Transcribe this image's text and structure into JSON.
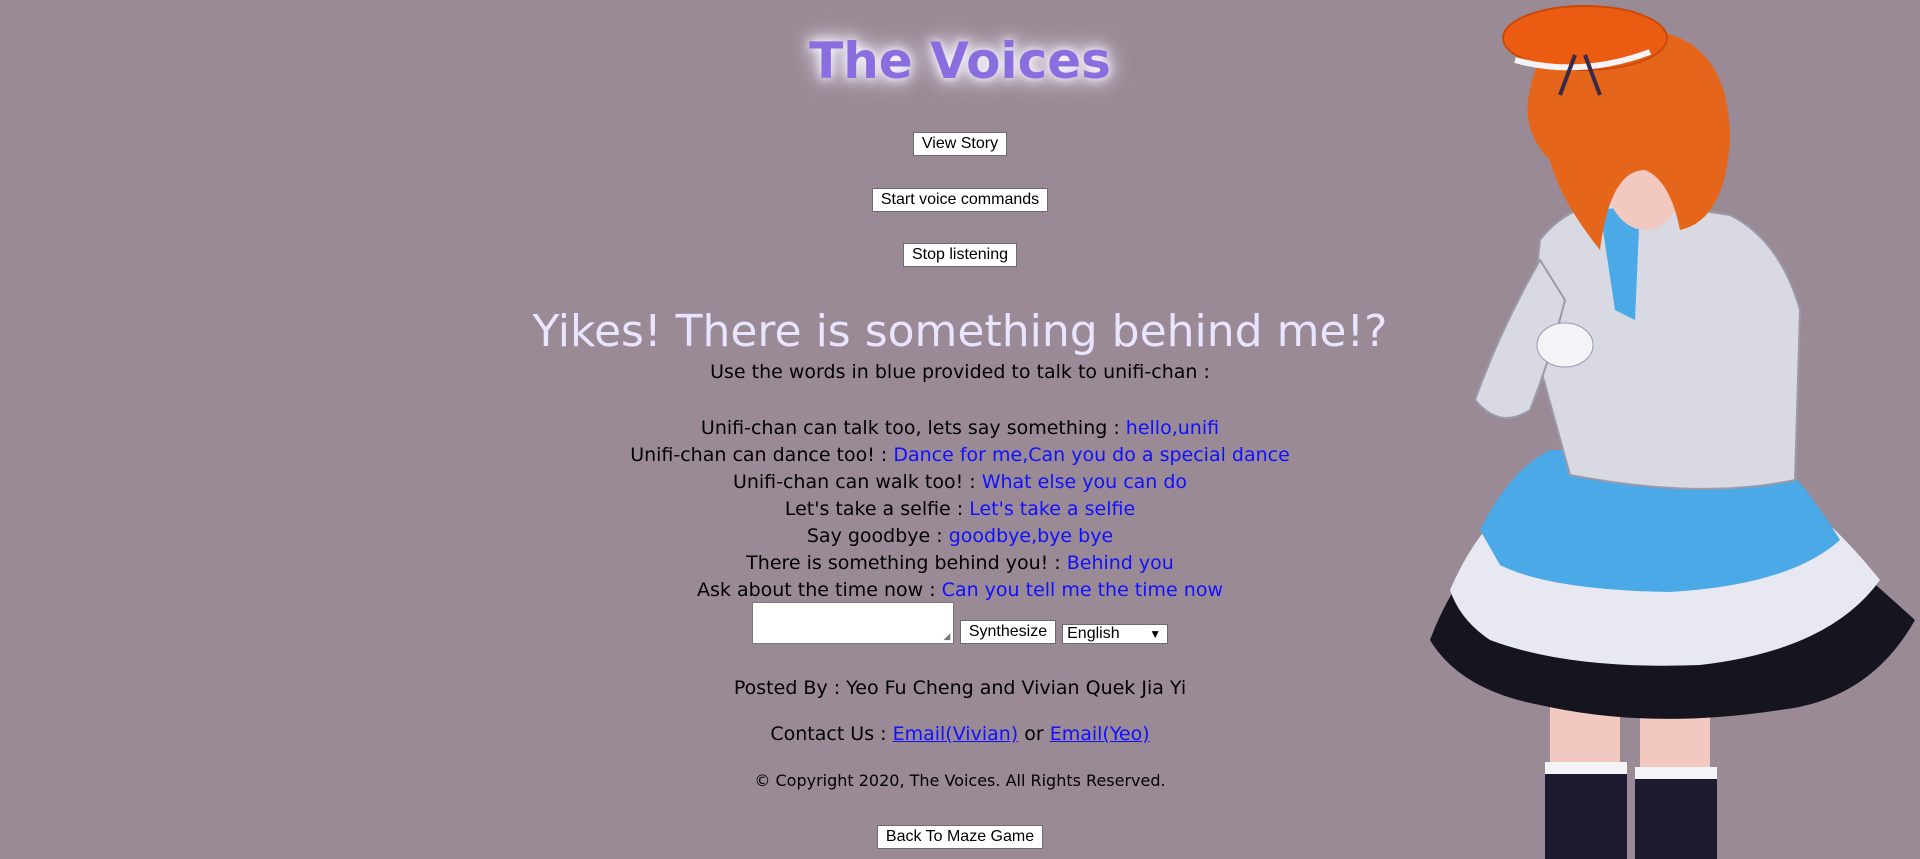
{
  "site": {
    "title": "The Voices"
  },
  "buttons": {
    "view_story": "View Story",
    "start_voice": "Start voice commands",
    "stop_listening": "Stop listening",
    "synthesize": "Synthesize",
    "back_to_maze": "Back To Maze Game"
  },
  "headline": "Yikes! There is something behind me!?",
  "subtitle": "Use the words in blue provided to talk to unifi-chan :",
  "commands": [
    {
      "label": "Unifi-chan can talk too, lets say something : ",
      "words": "hello,unifi"
    },
    {
      "label": "Unifi-chan can dance too! : ",
      "words": "Dance for me,Can you do a special dance"
    },
    {
      "label": "Unifi-chan can walk too! : ",
      "words": "What else you can do"
    },
    {
      "label": "Let's take a selfie : ",
      "words": "Let's take a selfie"
    },
    {
      "label": "Say goodbye : ",
      "words": "goodbye,bye bye"
    },
    {
      "label": "There is something behind you! : ",
      "words": "Behind you"
    },
    {
      "label": "Ask about the time now : ",
      "words": "Can you tell me the time now"
    }
  ],
  "synth": {
    "text_value": "",
    "language": "English"
  },
  "footer": {
    "posted_by": "Posted By : Yeo Fu Cheng and Vivian Quek Jia Yi",
    "contact_prefix": "Contact Us : ",
    "email_vivian": "Email(Vivian)",
    "or": " or ",
    "email_yeo": "Email(Yeo)",
    "copyright": "© Copyright 2020, The Voices. All Rights Reserved."
  },
  "colors": {
    "background": "#9a8a95",
    "title": "#8a6ee0",
    "headline": "#e9e4ff",
    "link_blue": "#1010ff"
  }
}
